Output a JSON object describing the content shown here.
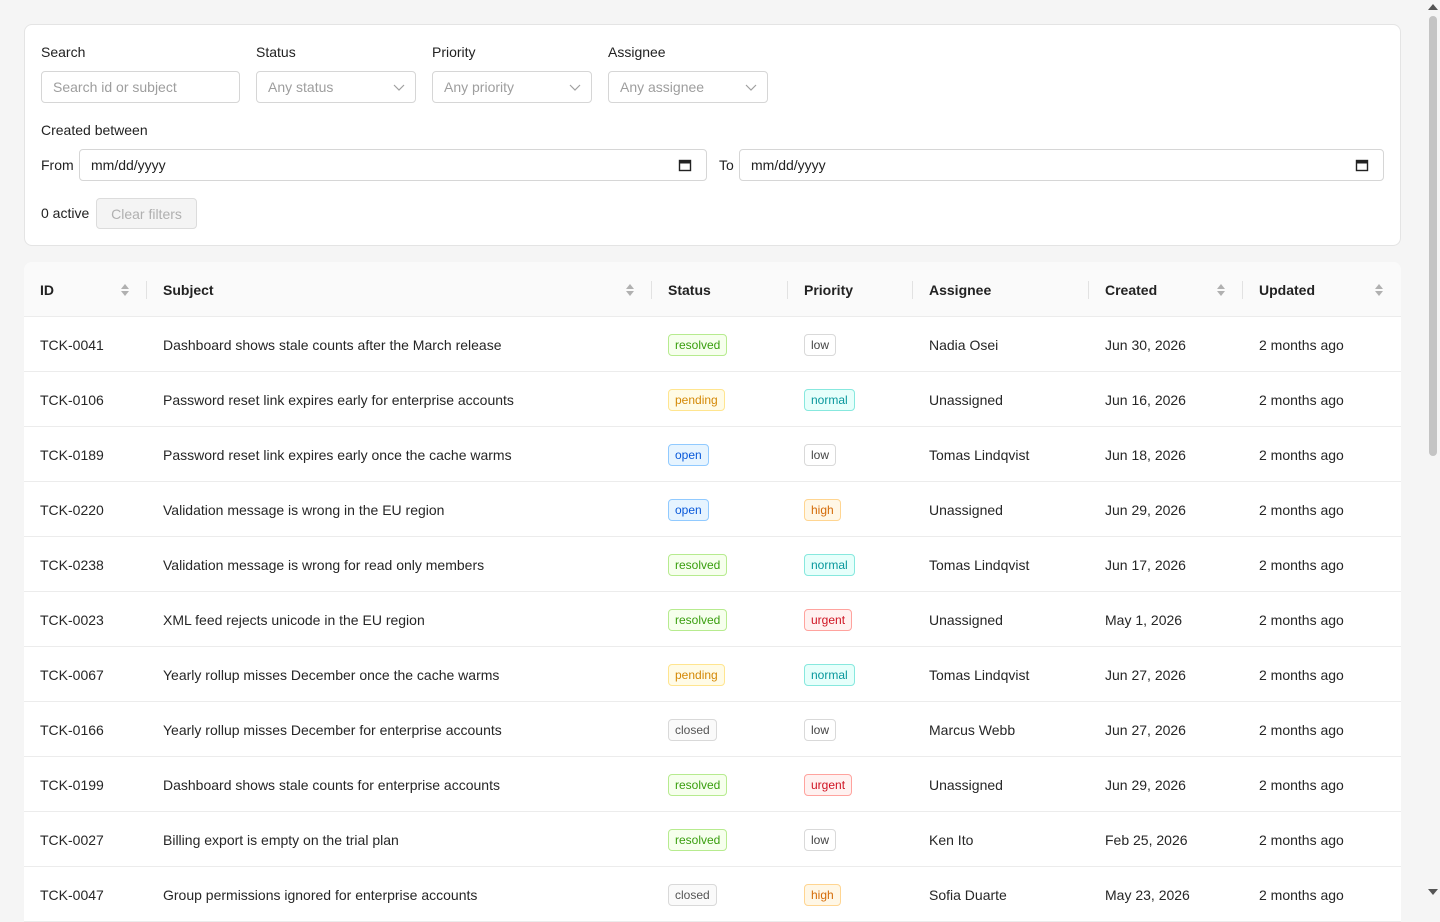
{
  "filters": {
    "search": {
      "label": "Search",
      "placeholder": "Search id or subject"
    },
    "status": {
      "label": "Status",
      "placeholder": "Any status"
    },
    "priority": {
      "label": "Priority",
      "placeholder": "Any priority"
    },
    "assignee": {
      "label": "Assignee",
      "placeholder": "Any assignee"
    },
    "created_between": "Created between",
    "from_label": "From",
    "to_label": "To",
    "from_value": "mm/dd/yyyy",
    "to_value": "mm/dd/yyyy",
    "active_count": "0 active",
    "clear_label": "Clear filters"
  },
  "table": {
    "columns": [
      "ID",
      "Subject",
      "Status",
      "Priority",
      "Assignee",
      "Created",
      "Updated"
    ],
    "rows": [
      {
        "id": "TCK-0041",
        "subject": "Dashboard shows stale counts after the March release",
        "status": "resolved",
        "priority": "low",
        "assignee": "Nadia Osei",
        "created": "Jun 30, 2026",
        "updated": "2 months ago"
      },
      {
        "id": "TCK-0106",
        "subject": "Password reset link expires early for enterprise accounts",
        "status": "pending",
        "priority": "normal",
        "assignee": "Unassigned",
        "created": "Jun 16, 2026",
        "updated": "2 months ago"
      },
      {
        "id": "TCK-0189",
        "subject": "Password reset link expires early once the cache warms",
        "status": "open",
        "priority": "low",
        "assignee": "Tomas Lindqvist",
        "created": "Jun 18, 2026",
        "updated": "2 months ago"
      },
      {
        "id": "TCK-0220",
        "subject": "Validation message is wrong in the EU region",
        "status": "open",
        "priority": "high",
        "assignee": "Unassigned",
        "created": "Jun 29, 2026",
        "updated": "2 months ago"
      },
      {
        "id": "TCK-0238",
        "subject": "Validation message is wrong for read only members",
        "status": "resolved",
        "priority": "normal",
        "assignee": "Tomas Lindqvist",
        "created": "Jun 17, 2026",
        "updated": "2 months ago"
      },
      {
        "id": "TCK-0023",
        "subject": "XML feed rejects unicode in the EU region",
        "status": "resolved",
        "priority": "urgent",
        "assignee": "Unassigned",
        "created": "May 1, 2026",
        "updated": "2 months ago"
      },
      {
        "id": "TCK-0067",
        "subject": "Yearly rollup misses December once the cache warms",
        "status": "pending",
        "priority": "normal",
        "assignee": "Tomas Lindqvist",
        "created": "Jun 27, 2026",
        "updated": "2 months ago"
      },
      {
        "id": "TCK-0166",
        "subject": "Yearly rollup misses December for enterprise accounts",
        "status": "closed",
        "priority": "low",
        "assignee": "Marcus Webb",
        "created": "Jun 27, 2026",
        "updated": "2 months ago"
      },
      {
        "id": "TCK-0199",
        "subject": "Dashboard shows stale counts for enterprise accounts",
        "status": "resolved",
        "priority": "urgent",
        "assignee": "Unassigned",
        "created": "Jun 29, 2026",
        "updated": "2 months ago"
      },
      {
        "id": "TCK-0027",
        "subject": "Billing export is empty on the trial plan",
        "status": "resolved",
        "priority": "low",
        "assignee": "Ken Ito",
        "created": "Feb 25, 2026",
        "updated": "2 months ago"
      },
      {
        "id": "TCK-0047",
        "subject": "Group permissions ignored for enterprise accounts",
        "status": "closed",
        "priority": "high",
        "assignee": "Sofia Duarte",
        "created": "May 23, 2026",
        "updated": "2 months ago"
      }
    ]
  },
  "tag_colors": {
    "resolved": {
      "bg": "#f6ffed",
      "border": "#b7eb8f",
      "fg": "#389e0d"
    },
    "pending": {
      "bg": "#fffbe6",
      "border": "#ffe58f",
      "fg": "#d48806"
    },
    "open": {
      "bg": "#e6f4ff",
      "border": "#91caff",
      "fg": "#0958d9"
    },
    "closed": {
      "bg": "#fafafa",
      "border": "#d9d9d9",
      "fg": "#555555"
    },
    "low": {
      "bg": "#ffffff",
      "border": "#d9d9d9",
      "fg": "#444444"
    },
    "normal": {
      "bg": "#e6fffb",
      "border": "#87e8de",
      "fg": "#08979c"
    },
    "high": {
      "bg": "#fff7e6",
      "border": "#ffd591",
      "fg": "#d46b08"
    },
    "urgent": {
      "bg": "#fff1f0",
      "border": "#ffa39e",
      "fg": "#cf1322"
    }
  }
}
